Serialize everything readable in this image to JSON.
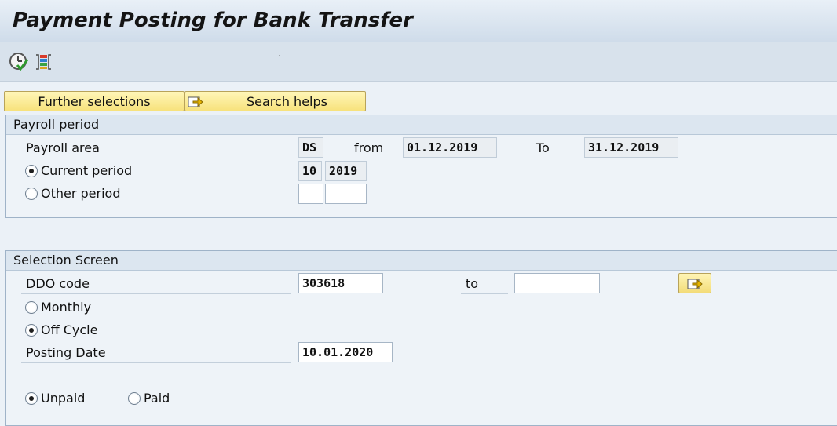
{
  "title": "Payment Posting for Bank Transfer",
  "toolbar": {
    "execute_icon": "execute-clock-icon",
    "variants_icon": "variants-list-icon",
    "dot": "·"
  },
  "buttons": {
    "further_selections": "Further selections",
    "search_helps": "Search helps"
  },
  "payroll_period": {
    "header": "Payroll period",
    "payroll_area_label": "Payroll area",
    "payroll_area_value": "DS",
    "from_label": "from",
    "from_value": "01.12.2019",
    "to_label": "To",
    "to_value": "31.12.2019",
    "current_period_label": "Current period",
    "current_period_num": "10",
    "current_period_year": "2019",
    "other_period_label": "Other period",
    "other_period_num": "",
    "other_period_year": ""
  },
  "selection_screen": {
    "header": "Selection Screen",
    "ddo_label": "DDO code",
    "ddo_value": "303618",
    "to_label": "to",
    "to_value": "",
    "monthly_label": "Monthly",
    "off_cycle_label": "Off Cycle",
    "posting_date_label": "Posting Date",
    "posting_date_value": "10.01.2020",
    "unpaid_label": "Unpaid",
    "paid_label": "Paid"
  },
  "colors": {
    "button_yellow": "#f7e27c",
    "frame_border": "#9fb3c8",
    "background": "#ebf1f7"
  }
}
